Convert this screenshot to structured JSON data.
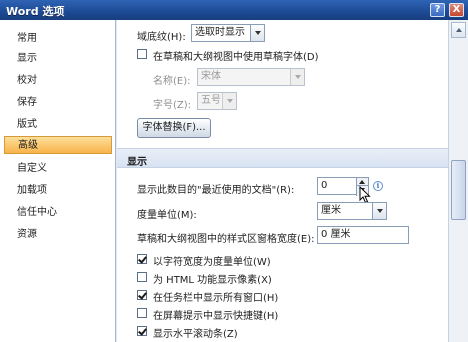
{
  "window": {
    "title": "Word 选项",
    "help_label": "?",
    "close_label": "X"
  },
  "sidebar": {
    "items": [
      {
        "label": "常用"
      },
      {
        "label": "显示"
      },
      {
        "label": "校对"
      },
      {
        "label": "保存"
      },
      {
        "label": "版式"
      },
      {
        "label": "高级",
        "selected": true
      },
      {
        "label": "自定义"
      },
      {
        "label": "加载项"
      },
      {
        "label": "信任中心"
      },
      {
        "label": "资源"
      }
    ]
  },
  "content": {
    "field_shading_label": "域底纹(H):",
    "field_shading_value": "选取时显示",
    "draft_font_checkbox": {
      "label": "在草稿和大纲视图中使用草稿字体(D)",
      "checked": false
    },
    "font_name_label": "名称(E):",
    "font_name_value": "宋体",
    "font_size_label": "字号(Z):",
    "font_size_value": "五号",
    "font_sub_button": "字体替换(F)...",
    "display_section_title": "显示",
    "recent_docs_label": "显示此数目的\"最近使用的文档\"(R):",
    "recent_docs_value": "0",
    "info_icon_glyph": "i",
    "units_label": "度量单位(M):",
    "units_value": "厘米",
    "style_area_label": "草稿和大纲视图中的样式区窗格宽度(E):",
    "style_area_value": "0 厘米",
    "checkboxes": [
      {
        "label": "以字符宽度为度量单位(W)",
        "checked": true
      },
      {
        "label": "为 HTML 功能显示像素(X)",
        "checked": false
      },
      {
        "label": "在任务栏中显示所有窗口(H)",
        "checked": true
      },
      {
        "label": "在屏幕提示中显示快捷键(H)",
        "checked": false
      },
      {
        "label": "显示水平滚动条(Z)",
        "checked": true
      }
    ]
  }
}
